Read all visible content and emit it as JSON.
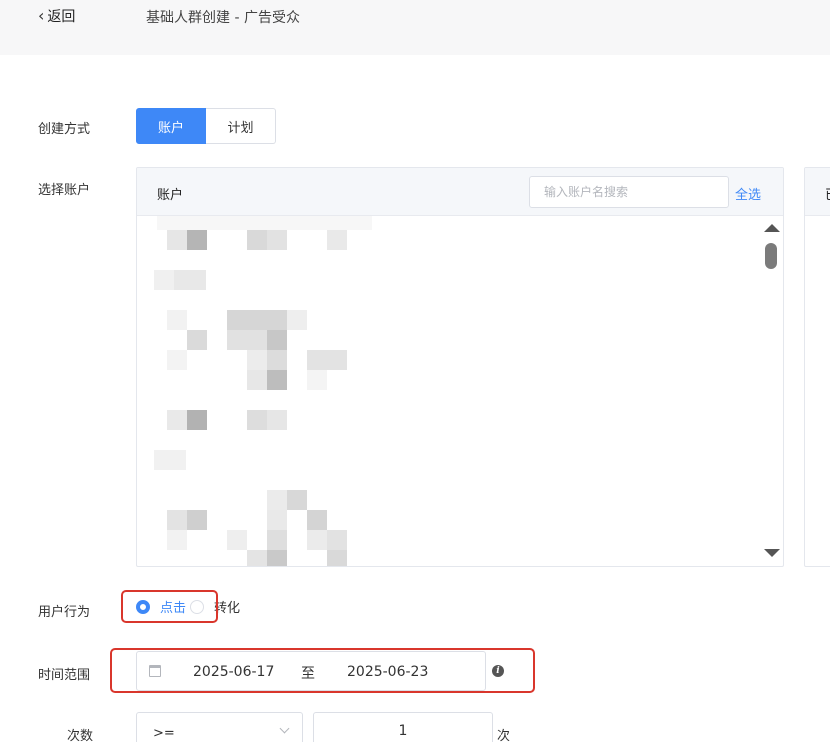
{
  "header": {
    "back_label": "返回",
    "title": "基础人群创建 - 广告受众"
  },
  "form": {
    "create_method": {
      "label": "创建方式",
      "options": [
        "账户",
        "计划"
      ],
      "selected": "账户"
    },
    "select_account": {
      "label": "选择账户",
      "panel_title": "账户",
      "search_placeholder": "输入账户名搜索",
      "select_all_label": "全选",
      "side_panel_title": "已"
    },
    "user_behavior": {
      "label": "用户行为",
      "options": [
        "点击",
        "转化"
      ],
      "selected": "点击"
    },
    "time_range": {
      "label": "时间范围",
      "start": "2025-06-17",
      "separator": "至",
      "end": "2025-06-23"
    },
    "count": {
      "label": "次数",
      "operator": ">=",
      "value": "1",
      "unit": "次"
    }
  },
  "colors": {
    "accent": "#3e88f7",
    "highlight_box": "#d9362c",
    "topbar_bg": "#f7f7f8",
    "panel_header_bg": "#f5f7fa"
  }
}
